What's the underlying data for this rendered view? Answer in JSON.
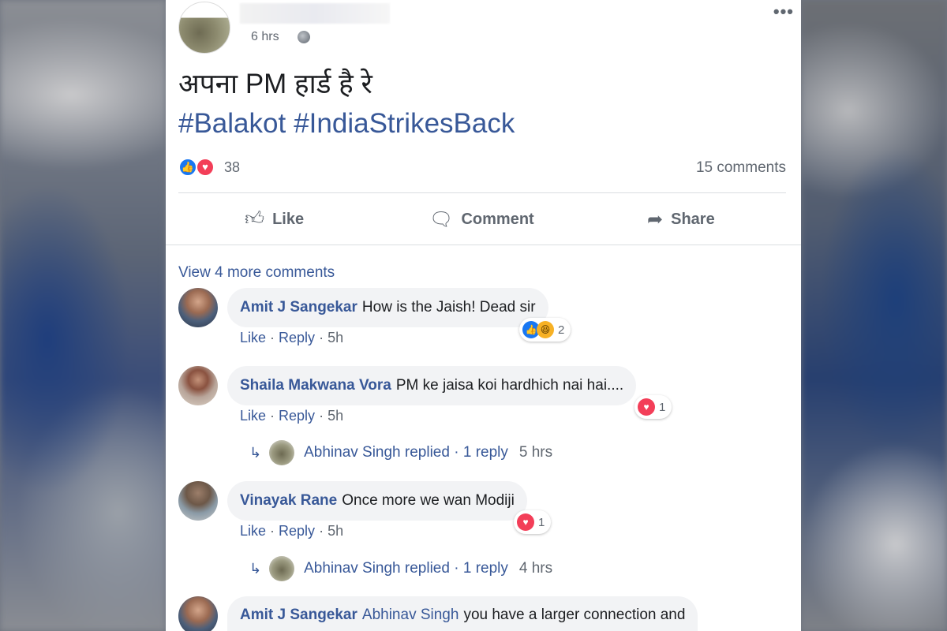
{
  "post": {
    "time": "6 hrs",
    "text": "अपना PM हार्ड है रे",
    "hashtags": [
      "#Balakot",
      "#IndiaStrikesBack"
    ],
    "reaction_count": "38",
    "comments_count": "15 comments",
    "actions": {
      "like": "Like",
      "comment": "Comment",
      "share": "Share"
    },
    "view_more": "View 4 more comments"
  },
  "comments": [
    {
      "name": "Amit J Sangekar",
      "text": "How is the Jaish! Dead sir",
      "like": "Like",
      "reply": "Reply",
      "time": "5h",
      "reaction_count": "2"
    },
    {
      "name": "Shaila Makwana Vora",
      "text": "PM ke jaisa koi hardhich nai hai....",
      "like": "Like",
      "reply": "Reply",
      "time": "5h",
      "reaction_count": "1",
      "replies": {
        "name": "Abhinav Singh replied",
        "link": "1 reply",
        "time": "5 hrs"
      }
    },
    {
      "name": "Vinayak Rane",
      "text": "Once more we wan Modiji",
      "like": "Like",
      "reply": "Reply",
      "time": "5h",
      "reaction_count": "1",
      "replies": {
        "name": "Abhinav Singh replied",
        "link": "1 reply",
        "time": "4 hrs"
      }
    },
    {
      "name": "Amit J Sangekar",
      "mention": "Abhinav Singh",
      "text": "you have a larger connection and"
    }
  ],
  "colors": {
    "link": "#385898",
    "like": "#1877f2",
    "love": "#f33e58",
    "meta": "#606770"
  }
}
